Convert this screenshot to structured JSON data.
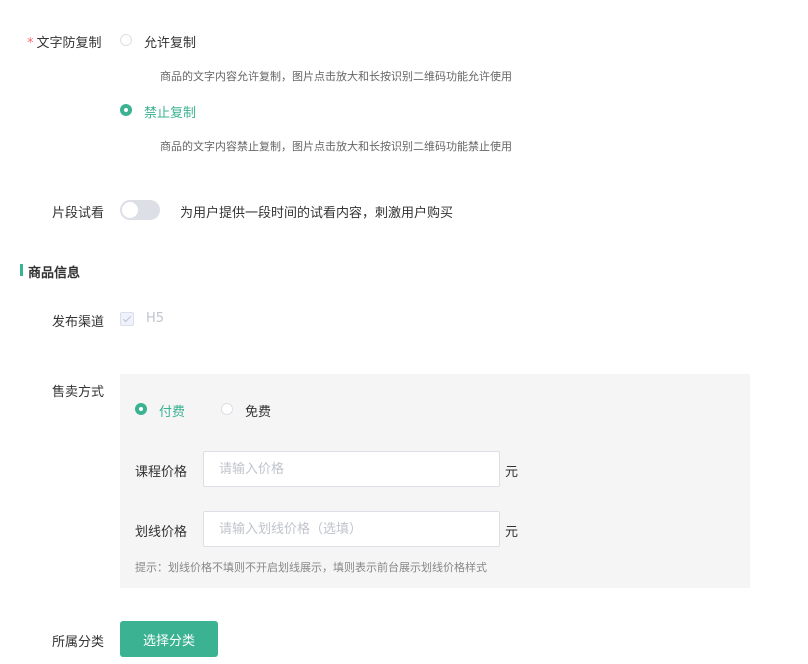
{
  "copy_protection": {
    "label": "文字防复制",
    "required_mark": "*",
    "options": [
      {
        "label": "允许复制",
        "description": "商品的文字内容允许复制，图片点击放大和长按识别二维码功能允许使用",
        "selected": false
      },
      {
        "label": "禁止复制",
        "description": "商品的文字内容禁止复制，图片点击放大和长按识别二维码功能禁止使用",
        "selected": true
      }
    ]
  },
  "trial": {
    "label": "片段试看",
    "enabled": false,
    "description": "为用户提供一段时间的试看内容，刺激用户购买"
  },
  "product_info": {
    "title": "商品信息"
  },
  "channel": {
    "label": "发布渠道",
    "option": "H5",
    "checked": true,
    "disabled": true
  },
  "sale_mode": {
    "label": "售卖方式",
    "options": [
      {
        "label": "付费",
        "selected": true
      },
      {
        "label": "免费",
        "selected": false
      }
    ],
    "course_price": {
      "label": "课程价格",
      "placeholder": "请输入价格",
      "value": "",
      "unit": "元"
    },
    "strike_price": {
      "label": "划线价格",
      "placeholder": "请输入划线价格（选填）",
      "value": "",
      "unit": "元"
    },
    "tip": "提示：划线价格不填则不开启划线展示，填则表示前台展示划线价格样式"
  },
  "category": {
    "label": "所属分类",
    "button_label": "选择分类"
  },
  "colors": {
    "accent": "#3bb291",
    "required": "#f56c6c",
    "panel_bg": "#f5f5f5"
  }
}
